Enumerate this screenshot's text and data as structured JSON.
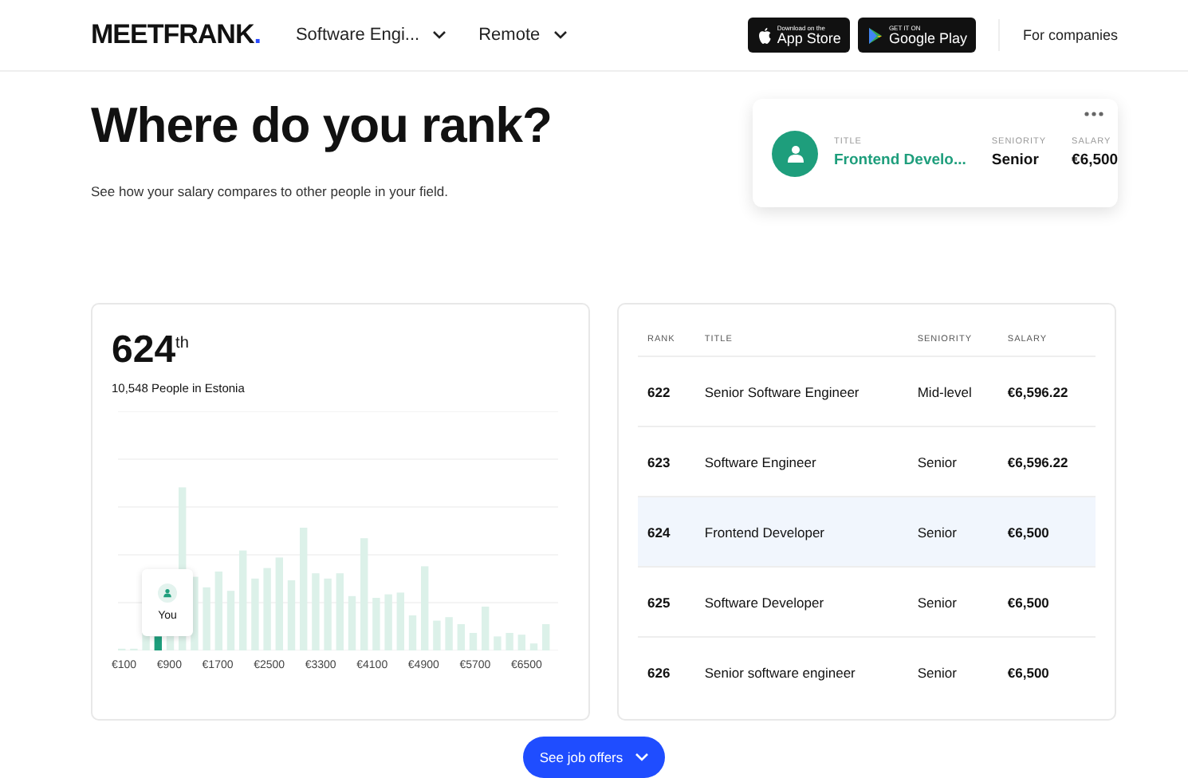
{
  "header": {
    "logo": "MEETFRANK",
    "logo_dot": ".",
    "filters": [
      {
        "label": "Software Engi..."
      },
      {
        "label": "Remote"
      }
    ],
    "stores": [
      {
        "kind": "apple",
        "small": "Download on the",
        "big": "App Store"
      },
      {
        "kind": "google",
        "small": "GET IT ON",
        "big": "Google Play"
      }
    ],
    "link": "For companies"
  },
  "hero": {
    "title": "Where do you rank?",
    "subtitle": "See how your salary compares to other people in your field."
  },
  "profile_card": {
    "columns": [
      {
        "label": "TITLE",
        "value": "Frontend Develo...",
        "kind": "accent"
      },
      {
        "label": "SENIORITY",
        "value": "Senior",
        "kind": "plain"
      },
      {
        "label": "SALARY",
        "value": "€6,500",
        "kind": "plain"
      }
    ]
  },
  "rank_panel": {
    "rank": "624",
    "suffix": "th",
    "population": "10,548 People in Estonia",
    "marker_label": "You",
    "axis_labels": [
      "€100",
      "€900",
      "€1700",
      "€2500",
      "€3300",
      "€4100",
      "€4900",
      "€5700",
      "€6500"
    ]
  },
  "ranking_table": {
    "columns": [
      "RANK",
      "TITLE",
      "SENIORITY",
      "SALARY"
    ],
    "rows": [
      {
        "rank": "622",
        "title": "Senior Software Engineer",
        "seniority": "Mid-level",
        "salary": "€6,596.22",
        "selected": false
      },
      {
        "rank": "623",
        "title": "Software Engineer",
        "seniority": "Senior",
        "salary": "€6,596.22",
        "selected": false
      },
      {
        "rank": "624",
        "title": "Frontend Developer",
        "seniority": "Senior",
        "salary": "€6,500",
        "selected": true
      },
      {
        "rank": "625",
        "title": "Software Developer",
        "seniority": "Senior",
        "salary": "€6,500",
        "selected": false
      },
      {
        "rank": "626",
        "title": "Senior software engineer",
        "seniority": "Senior",
        "salary": "€6,500",
        "selected": false
      }
    ]
  },
  "cta": {
    "label": "See job offers"
  }
}
